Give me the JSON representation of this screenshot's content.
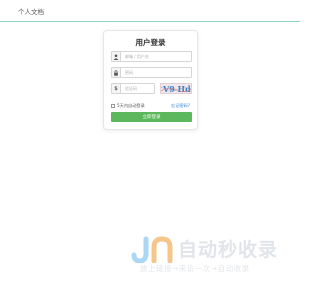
{
  "header": {
    "site_title": "个人文档"
  },
  "login": {
    "title": "用户登录",
    "username_placeholder": "邮箱 / 用户名",
    "password_placeholder": "密码",
    "captcha_placeholder": "验证码",
    "captcha_text": "V9 Hd",
    "remember_label": "5天内自动登录",
    "forgot_label": "忘记密码?",
    "submit_label": "立即登录"
  },
  "watermark": {
    "main": "自动秒收录",
    "sub": "放上链接→来访一次→自动收录"
  }
}
